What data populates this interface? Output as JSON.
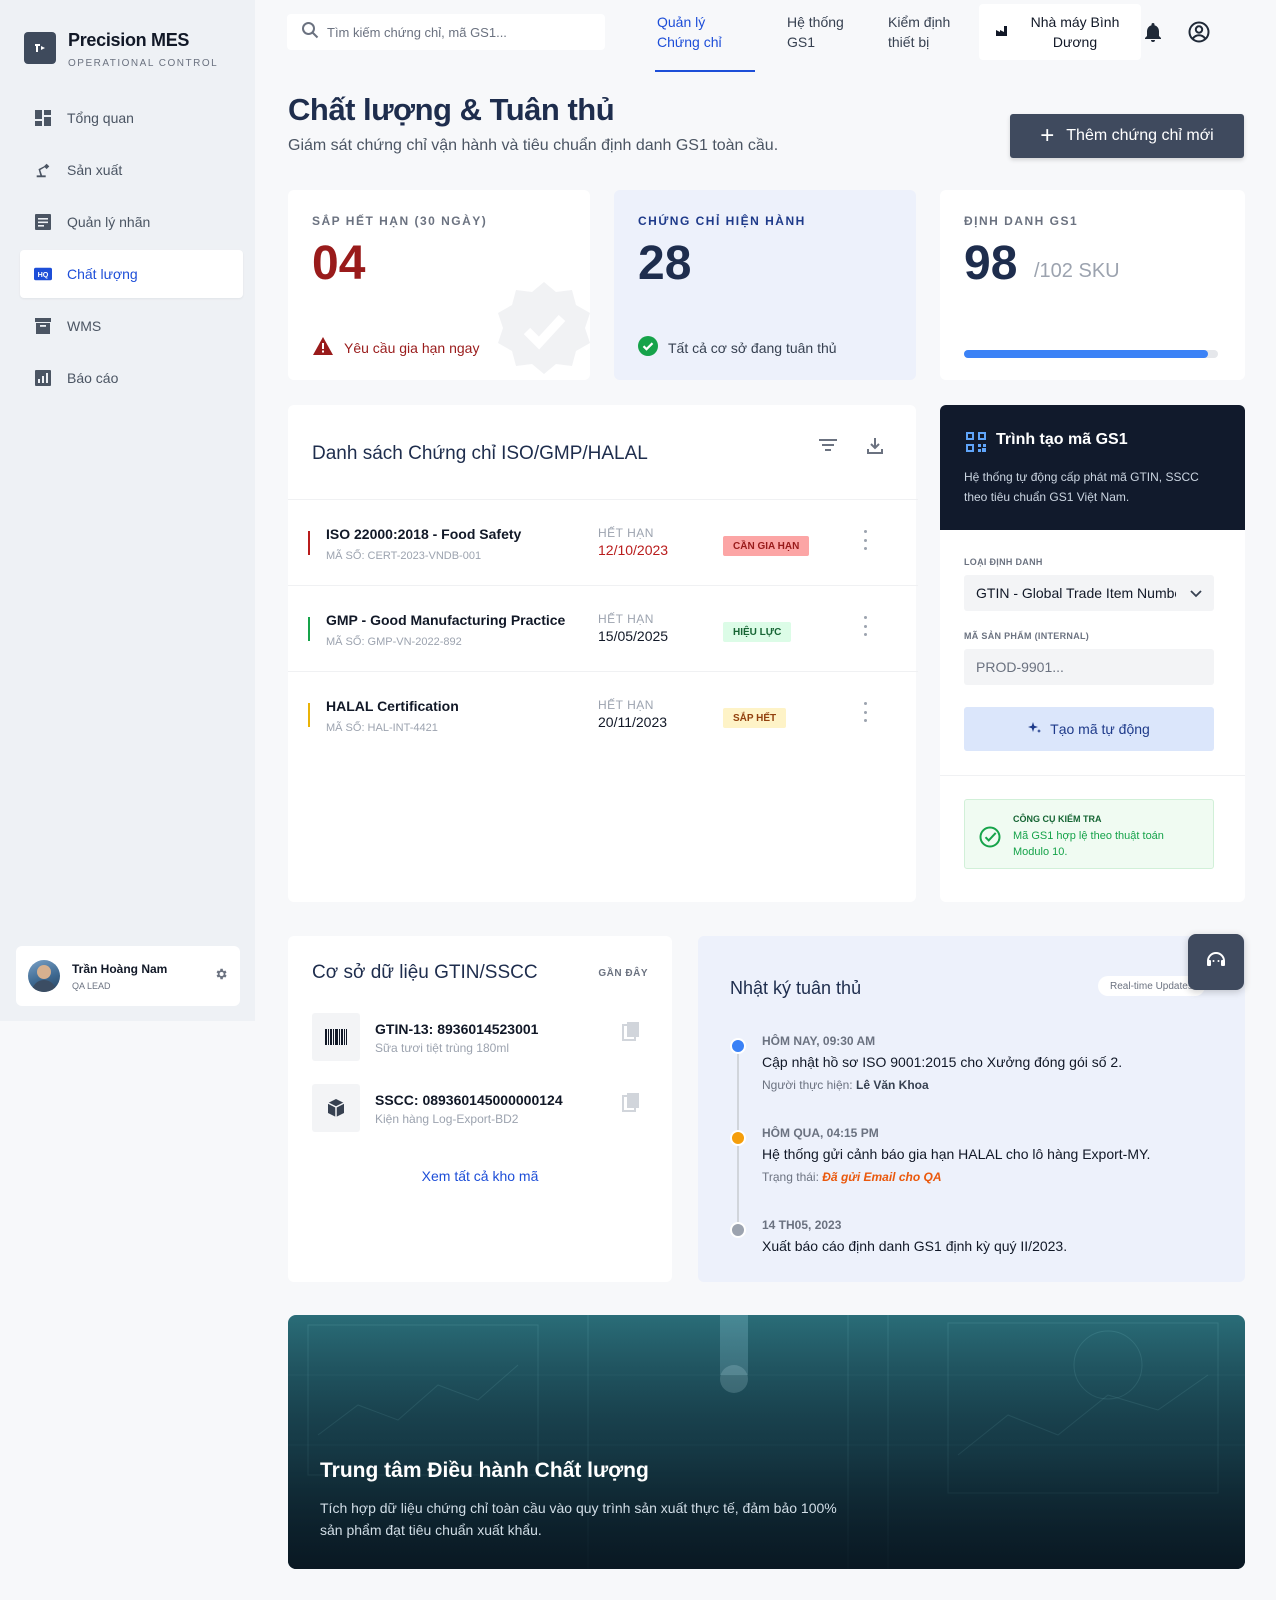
{
  "brand": {
    "title": "Precision MES",
    "subtitle": "OPERATIONAL CONTROL"
  },
  "sidebar": {
    "items": [
      {
        "label": "Tổng quan",
        "icon": "dashboard-icon"
      },
      {
        "label": "Sản xuất",
        "icon": "robot-arm-icon"
      },
      {
        "label": "Quản lý nhãn",
        "icon": "label-icon"
      },
      {
        "label": "Chất lượng",
        "icon": "hq-icon",
        "active": true
      },
      {
        "label": "WMS",
        "icon": "warehouse-icon"
      },
      {
        "label": "Báo cáo",
        "icon": "report-icon"
      }
    ]
  },
  "user": {
    "name": "Trần Hoàng Nam",
    "role": "QA LEAD"
  },
  "topbar": {
    "search_placeholder": "Tìm kiếm chứng chỉ, mã GS1...",
    "tabs": [
      {
        "line1": "Quản lý",
        "line2": "Chứng chỉ",
        "active": true
      },
      {
        "line1": "Hệ thống",
        "line2": "GS1"
      },
      {
        "line1": "Kiểm định",
        "line2": "thiết bị"
      }
    ],
    "factory": {
      "line1": "Nhà máy Bình",
      "line2": "Dương"
    }
  },
  "page": {
    "title": "Chất lượng & Tuân thủ",
    "subtitle": "Giám sát chứng chỉ vận hành và tiêu chuẩn định danh GS1 toàn cầu.",
    "add_button": "Thêm chứng chỉ mới"
  },
  "stats": {
    "expiring": {
      "label": "SẮP HẾT HẠN (30 NGÀY)",
      "value": "04",
      "note": "Yêu cầu gia hạn ngay"
    },
    "active": {
      "label": "CHỨNG CHỈ HIỆN HÀNH",
      "value": "28",
      "note": "Tất cả cơ sở đang tuân thủ"
    },
    "gs1": {
      "label": "ĐỊNH DANH GS1",
      "value": "98",
      "unit": "/102 SKU",
      "progress": 0.96
    }
  },
  "cert_list": {
    "title": "Danh sách Chứng chỉ ISO/GMP/HALAL",
    "expiry_label": "HẾT HẠN",
    "items": [
      {
        "name": "ISO 22000:2018 - Food Safety",
        "code": "MÃ SỐ: CERT-2023-VNDB-001",
        "expiry": "12/10/2023",
        "status": "CẦN GIA HẠN",
        "color": "#b91c1c",
        "badge_bg": "#fca5a5",
        "badge_fg": "#991b1b"
      },
      {
        "name": "GMP - Good Manufacturing Practice",
        "code": "MÃ SỐ: GMP-VN-2022-892",
        "expiry": "15/05/2025",
        "status": "HIỆU LỰC",
        "color": "#16a34a",
        "badge_bg": "#dcfce7",
        "badge_fg": "#166534"
      },
      {
        "name": "HALAL Certification",
        "code": "MÃ SỐ: HAL-INT-4421",
        "expiry": "20/11/2023",
        "status": "SẮP HẾT",
        "color": "#eab308",
        "badge_bg": "#fef3c7",
        "badge_fg": "#92400e"
      }
    ]
  },
  "generator": {
    "title": "Trình tạo mã GS1",
    "desc": "Hệ thống tự động cấp phát mã GTIN, SSCC theo tiêu chuẩn GS1 Việt Nam.",
    "type_label": "LOẠI ĐỊNH DANH",
    "type_value": "GTIN - Global Trade Item Number",
    "product_label": "MÃ SẢN PHẨM (INTERNAL)",
    "product_placeholder": "PROD-9901...",
    "button": "Tạo mã tự động",
    "check_title": "CÔNG CỤ KIỂM TRA",
    "check_desc": "Mã GS1 hợp lệ theo thuật toán Modulo 10."
  },
  "database": {
    "title": "Cơ sở dữ liệu GTIN/SSCC",
    "recent": "GẦN ĐÂY",
    "items": [
      {
        "code": "GTIN-13: 8936014523001",
        "desc": "Sữa tươi tiệt trùng 180ml",
        "icon": "barcode-icon"
      },
      {
        "code": "SSCC: 089360145000000124",
        "desc": "Kiện hàng Log-Export-BD2",
        "icon": "package-icon"
      }
    ],
    "view_all": "Xem tất cả kho mã"
  },
  "log": {
    "title": "Nhật ký tuân thủ",
    "badge": "Real-time Updates",
    "entries": [
      {
        "time": "HÔM NAY, 09:30 AM",
        "text": "Cập nhật hồ sơ ISO 9001:2015 cho Xưởng đóng gói số 2.",
        "meta_label": "Người thực hiện: ",
        "meta_value": "Lê Văn Khoa",
        "dot": "#3b82f6"
      },
      {
        "time": "HÔM QUA, 04:15 PM",
        "text": "Hệ thống gửi cảnh báo gia hạn HALAL cho lô hàng Export-MY.",
        "meta_label": "Trạng thái: ",
        "meta_value": "Đã gửi Email cho QA",
        "dot": "#f59e0b"
      },
      {
        "time": "14 TH05, 2023",
        "text": "Xuất báo cáo định danh GS1 định kỳ quý II/2023.",
        "dot": "#9ca3af"
      }
    ]
  },
  "hero": {
    "title": "Trung tâm Điều hành Chất lượng",
    "desc": "Tích hợp dữ liệu chứng chỉ toàn cầu vào quy trình sản xuất thực tế, đảm bảo 100% sản phẩm đạt tiêu chuẩn xuất khẩu."
  }
}
